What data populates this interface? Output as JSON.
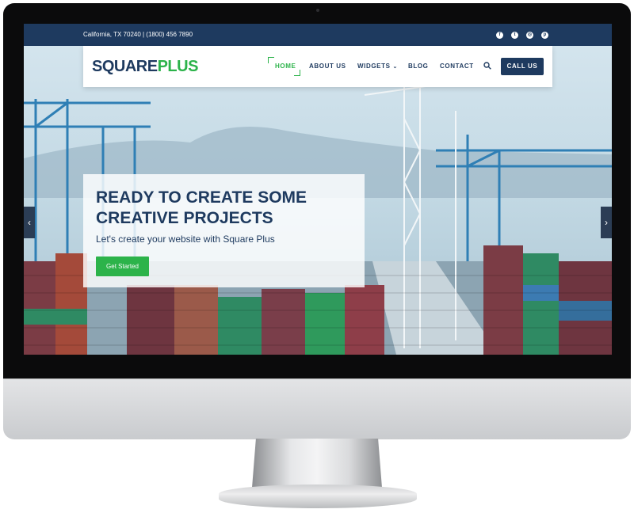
{
  "topbar": {
    "contact": "California, TX 70240 | (1800) 456 7890",
    "social_icons": [
      "facebook-icon",
      "twitter-icon",
      "instagram-icon",
      "pinterest-icon"
    ]
  },
  "navbar": {
    "logo_part1": "SQUARE",
    "logo_part2": "PLUS",
    "items": [
      {
        "label": "HOME",
        "active": true
      },
      {
        "label": "ABOUT US",
        "active": false
      },
      {
        "label": "WIDGETS",
        "active": false,
        "dropdown": true
      },
      {
        "label": "BLOG",
        "active": false
      },
      {
        "label": "CONTACT",
        "active": false
      }
    ],
    "search_icon": "search-icon",
    "call_label": "CALL US"
  },
  "hero": {
    "title_line1": "READY TO CREATE SOME",
    "title_line2": "CREATIVE PROJECTS",
    "subtitle": "Let's create your website with Square Plus",
    "cta_label": "Get Started",
    "prev_icon": "chevron-left-icon",
    "next_icon": "chevron-right-icon"
  },
  "colors": {
    "navy": "#1e3a5f",
    "green": "#2cb34a",
    "white": "#ffffff"
  }
}
